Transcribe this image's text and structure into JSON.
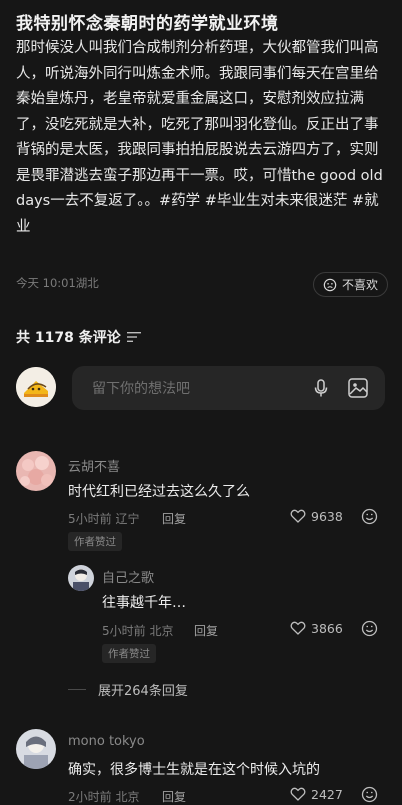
{
  "post": {
    "title": "我特别怀念秦朝时的药学就业环境",
    "body": "那时候没人叫我们合成制剂分析药理，大伙都管我们叫高人，听说海外同行叫炼金术师。我跟同事们每天在宫里给秦始皇炼丹，老皇帝就爱重金属这口，安慰剂效应拉满了，没吃死就是大补，吃死了那叫羽化登仙。反正出了事背锅的是太医，我跟同事拍拍屁股说去云游四方了，实则是畏罪潜逃去蛮子那边再干一票。哎，可惜the good old days一去不复返了。。#药学 #毕业生对未来很迷茫 #就业",
    "meta": "今天 10:01湖北",
    "dislike_label": "不喜欢"
  },
  "comments_header": {
    "count_label": "共 1178 条评论"
  },
  "input": {
    "placeholder": "留下你的想法吧"
  },
  "comments": [
    {
      "user": "云胡不喜",
      "text": "时代红利已经过去这么久了么",
      "time": "5小时前 辽宁",
      "reply": "回复",
      "likes": "9638",
      "badge": "作者赞过"
    },
    {
      "user": "自己之歌",
      "text": "往事越千年…",
      "time": "5小时前 北京",
      "reply": "回复",
      "likes": "3866",
      "badge": "作者赞过"
    },
    {
      "user": "mono tokyo",
      "text": "确实，很多博士生就是在这个时候入坑的",
      "time": "2小时前 北京",
      "reply": "回复",
      "likes": "2427"
    }
  ],
  "expand_label": "展开264条回复",
  "colors": {
    "background": "#161616",
    "text": "#e8e8e8",
    "muted": "#7b7b7b"
  },
  "icons": [
    "dislike-face-icon",
    "sort-icon",
    "mic-icon",
    "image-icon",
    "heart-icon",
    "emoji-icon"
  ]
}
